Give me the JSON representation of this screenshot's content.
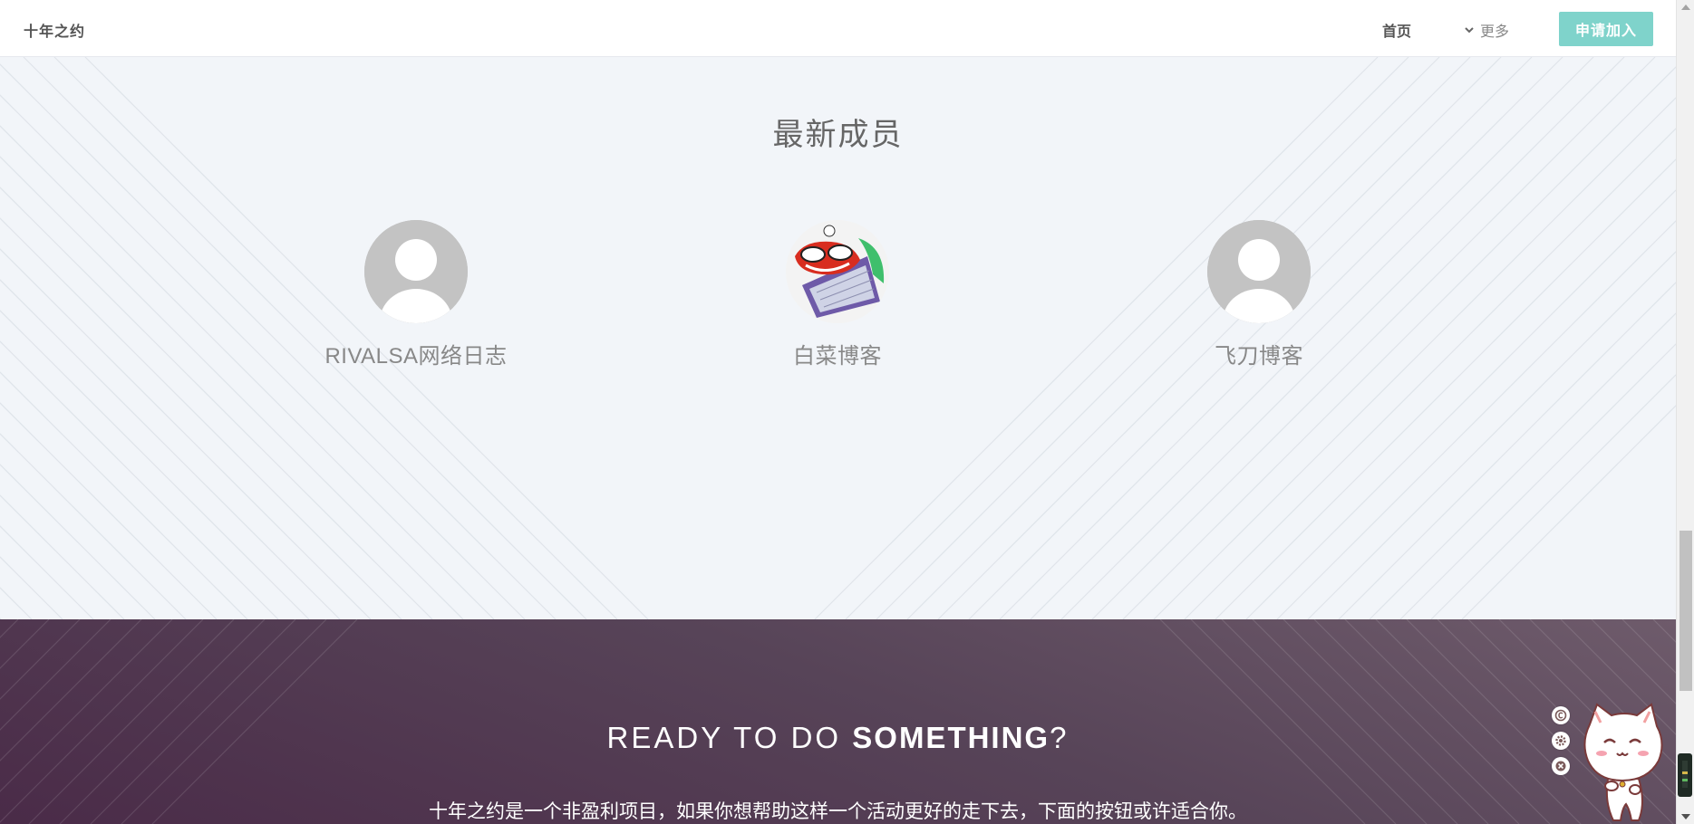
{
  "header": {
    "brand": "十年之约",
    "nav_home": "首页",
    "nav_more": "更多",
    "join_button": "申请加入"
  },
  "members_section": {
    "title": "最新成员",
    "members": [
      {
        "name": "RIVALSA网络日志",
        "avatar": "default-avatar"
      },
      {
        "name": "白菜博客",
        "avatar": "custom-cartoon-avatar"
      },
      {
        "name": "飞刀博客",
        "avatar": "default-avatar"
      }
    ]
  },
  "cta": {
    "title_light": "READY TO DO ",
    "title_strong": "SOMETHING",
    "title_end": "?",
    "description": "十年之约是一个非盈利项目，如果你想帮助这样一个活动更好的走下去，下面的按钮或许适合你。"
  },
  "widget": {
    "tools": [
      "copyright-icon",
      "settings-icon",
      "close-icon"
    ],
    "mascot": "cat-mascot-icon"
  },
  "colors": {
    "accent": "#7fd3cb",
    "section_bg": "#f2f5f9",
    "cta_bg": "#574458"
  }
}
